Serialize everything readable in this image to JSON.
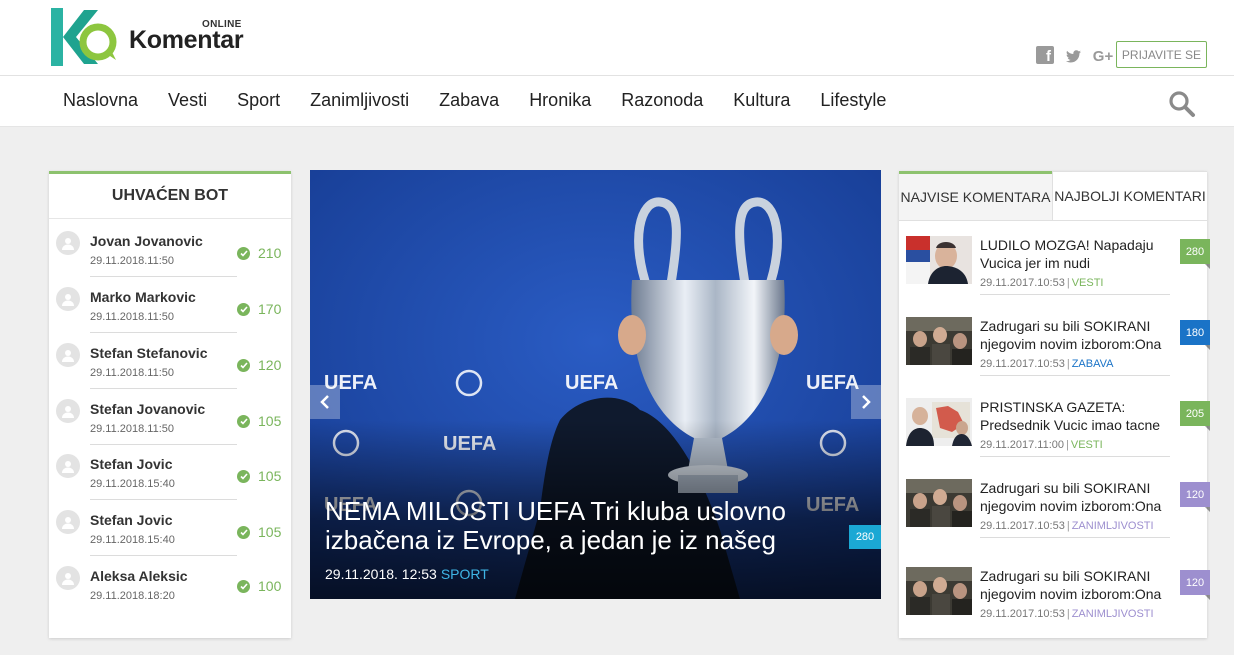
{
  "header": {
    "brand": "Komentar",
    "brand_tag": "ONLINE",
    "social": {
      "facebook": "f",
      "twitter": "twitter-icon",
      "googleplus": "G+"
    },
    "login_label": "PRIJAVITE SE"
  },
  "nav": {
    "items": [
      "Naslovna",
      "Vesti",
      "Sport",
      "Zanimljivosti",
      "Zabava",
      "Hronika",
      "Razonoda",
      "Kultura",
      "Lifestyle"
    ]
  },
  "colors": {
    "accent_green": "#7ab55c",
    "vesti": "#7ab55c",
    "zabava": "#1a73c7",
    "zanimljivosti": "#9d8fcf",
    "sport": "#3fb5e6"
  },
  "bot_widget": {
    "title": "UHVAĆEN BOT",
    "items": [
      {
        "name": "Jovan Jovanovic",
        "date": "29.11.2018.11:50",
        "score": "210"
      },
      {
        "name": "Marko Markovic",
        "date": "29.11.2018.11:50",
        "score": "170"
      },
      {
        "name": "Stefan Stefanovic",
        "date": "29.11.2018.11:50",
        "score": "120"
      },
      {
        "name": "Stefan Jovanovic",
        "date": "29.11.2018.11:50",
        "score": "105"
      },
      {
        "name": "Stefan Jovic",
        "date": "29.11.2018.15:40",
        "score": "105"
      },
      {
        "name": "Stefan Jovic",
        "date": "29.11.2018.15:40",
        "score": "105"
      },
      {
        "name": "Aleksa Aleksic",
        "date": "29.11.2018.18:20",
        "score": "100"
      }
    ]
  },
  "hero": {
    "title": "NEMA MILOSTI UEFA Tri kluba uslovno izbačena iz Evrope, a jedan je iz našeg",
    "date": "29.11.2018. 12:53",
    "category": "SPORT",
    "comments": "280",
    "backdrop_text": "UEFA"
  },
  "comments_widget": {
    "tabs": [
      "NAJVISE KOMENTARA",
      "NAJBOLJI KOMENTARI"
    ],
    "items": [
      {
        "title": "LUDILO MOZGA! Napadaju Vucica jer im nudi",
        "date": "29.11.2017.10:53",
        "category": "VESTI",
        "cat_color": "#7ab55c",
        "count": "280"
      },
      {
        "title": "Zadrugari su bili SOKIRANI njegovim novim izborom:Ona",
        "date": "29.11.2017.10:53",
        "category": "ZABAVA",
        "cat_color": "#1a73c7",
        "count": "180"
      },
      {
        "title": "PRISTINSKA GAZETA: Predsednik Vucic imao tacne",
        "date": "29.11.2017.11:00",
        "category": "VESTI",
        "cat_color": "#7ab55c",
        "count": "205"
      },
      {
        "title": "Zadrugari su bili SOKIRANI njegovim novim izborom:Ona",
        "date": "29.11.2017.10:53",
        "category": "ZANIMLJIVOSTI",
        "cat_color": "#9d8fcf",
        "count": "120"
      },
      {
        "title": "Zadrugari su bili SOKIRANI njegovim novim izborom:Ona",
        "date": "29.11.2017.10:53",
        "category": "ZANIMLJIVOSTI",
        "cat_color": "#9d8fcf",
        "count": "120"
      }
    ]
  }
}
